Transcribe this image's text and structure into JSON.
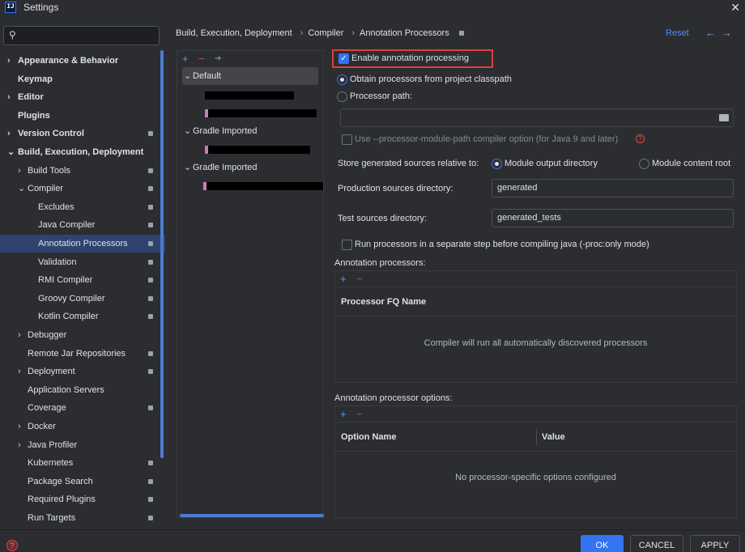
{
  "window": {
    "title": "Settings",
    "app_icon": "IJ",
    "close_glyph": "✕"
  },
  "sidebar": {
    "search_placeholder": "",
    "items": [
      {
        "label": "Appearance & Behavior",
        "chev": "›",
        "bold": true
      },
      {
        "label": "Keymap",
        "bold": true
      },
      {
        "label": "Editor",
        "chev": "›",
        "bold": true
      },
      {
        "label": "Plugins",
        "bold": true
      },
      {
        "label": "Version Control",
        "chev": "›",
        "bold": true,
        "pin": true
      },
      {
        "label": "Build, Execution, Deployment",
        "chev": "⌄",
        "bold": true
      },
      {
        "label": "Build Tools",
        "chev": "›",
        "pin": true
      },
      {
        "label": "Compiler",
        "chev": "⌄",
        "pin": true
      },
      {
        "label": "Excludes",
        "pin": true
      },
      {
        "label": "Java Compiler",
        "pin": true
      },
      {
        "label": "Annotation Processors",
        "pin": true,
        "selected": true
      },
      {
        "label": "Validation",
        "pin": true
      },
      {
        "label": "RMI Compiler",
        "pin": true
      },
      {
        "label": "Groovy Compiler",
        "pin": true
      },
      {
        "label": "Kotlin Compiler",
        "pin": true
      },
      {
        "label": "Debugger",
        "chev": "›"
      },
      {
        "label": "Remote Jar Repositories",
        "pin": true
      },
      {
        "label": "Deployment",
        "chev": "›",
        "pin": true
      },
      {
        "label": "Application Servers"
      },
      {
        "label": "Coverage",
        "pin": true
      },
      {
        "label": "Docker",
        "chev": "›"
      },
      {
        "label": "Java Profiler",
        "chev": "›"
      },
      {
        "label": "Kubernetes",
        "pin": true
      },
      {
        "label": "Package Search",
        "pin": true
      },
      {
        "label": "Required Plugins",
        "pin": true
      },
      {
        "label": "Run Targets",
        "pin": true
      }
    ]
  },
  "breadcrumb": {
    "items": [
      "Build, Execution, Deployment",
      "Annotation Processors"
    ],
    "middle": "Compiler",
    "sep": "›",
    "reset": "Reset",
    "back": "←",
    "forward": "→"
  },
  "profiles": {
    "add": "+",
    "remove": "−",
    "move": "➔",
    "rows": [
      {
        "label": "Default",
        "chev": "⌄"
      },
      {
        "label": "Gradle Imported",
        "chev": "⌄"
      },
      {
        "label": "Gradle Imported",
        "chev": "⌄"
      }
    ]
  },
  "settings": {
    "enable": "Enable annotation processing",
    "obtain": "Obtain processors from project classpath",
    "processor_path": "Processor path:",
    "processor_path_value": "",
    "module_path_option": "Use --processor-module-path compiler option (for Java 9 and later)",
    "store_relative": "Store generated sources relative to:",
    "module_output": "Module output directory",
    "module_content": "Module content root",
    "prod_dir_label": "Production sources directory:",
    "prod_dir_value": "generated",
    "test_dir_label": "Test sources directory:",
    "test_dir_value": "generated_tests",
    "separate_step": "Run processors in a separate step before compiling java (-proc:only mode)"
  },
  "processors_table": {
    "title": "Annotation processors:",
    "add": "+",
    "remove": "−",
    "col": "Processor FQ Name",
    "empty": "Compiler will run all automatically discovered processors"
  },
  "options_table": {
    "title": "Annotation processor options:",
    "add": "+",
    "remove": "−",
    "col1": "Option Name",
    "col2": "Value",
    "empty": "No processor-specific options configured"
  },
  "footer": {
    "ok": "OK",
    "cancel": "CANCEL",
    "apply": "APPLY",
    "help": "?"
  },
  "colors": {
    "accent": "#3574f0",
    "highlight": "#d9413a",
    "selected_row": "#2e436e"
  }
}
